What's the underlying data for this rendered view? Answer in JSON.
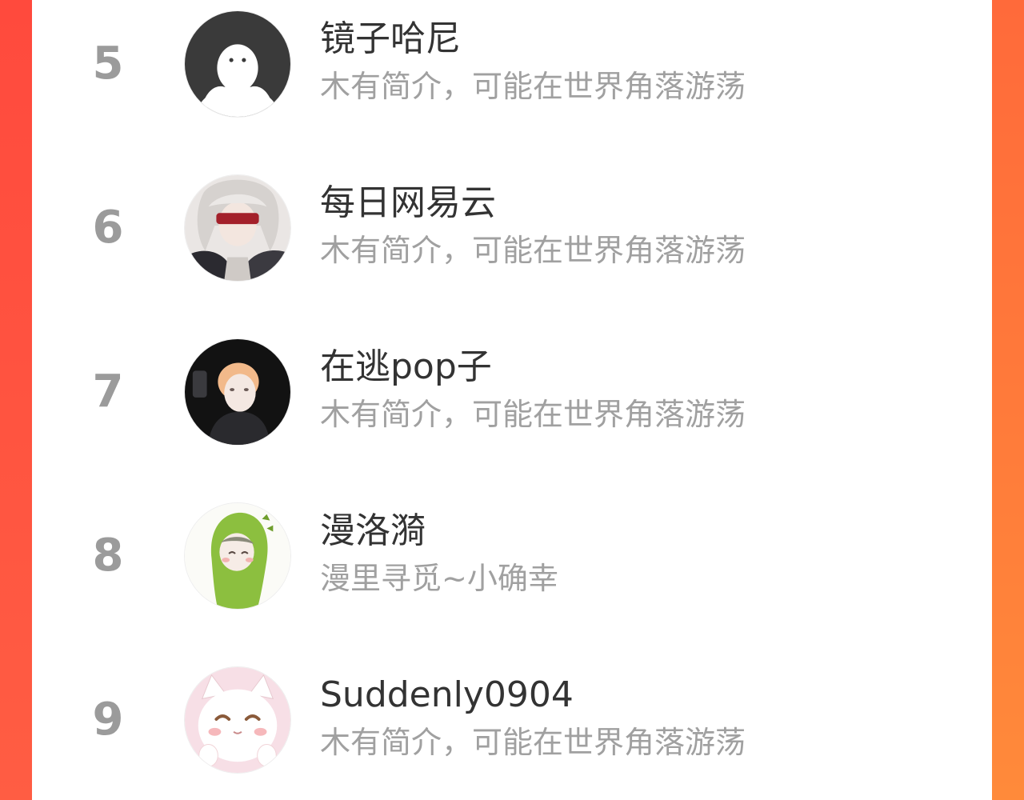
{
  "colors": {
    "rank_text": "#9b9b9b",
    "name_text": "#333333",
    "bio_text": "#a0a0a0",
    "accent_gradient_start": "#ff4b3e",
    "accent_gradient_end": "#ff8a3a"
  },
  "users": [
    {
      "rank": "5",
      "name": "镜子哈尼",
      "bio": "木有简介，可能在世界角落游荡",
      "avatar_icon": "default-ghost-avatar"
    },
    {
      "rank": "6",
      "name": "每日网易云",
      "bio": "木有简介，可能在世界角落游荡",
      "avatar_icon": "anime-character-avatar"
    },
    {
      "rank": "7",
      "name": "在逃pop子",
      "bio": "木有简介，可能在世界角落游荡",
      "avatar_icon": "dark-portrait-avatar"
    },
    {
      "rank": "8",
      "name": "漫洛漪",
      "bio": "漫里寻觅~小确幸",
      "avatar_icon": "green-hood-avatar"
    },
    {
      "rank": "9",
      "name": "Suddenly0904",
      "bio": "木有简介，可能在世界角落游荡",
      "avatar_icon": "white-cat-avatar"
    }
  ]
}
